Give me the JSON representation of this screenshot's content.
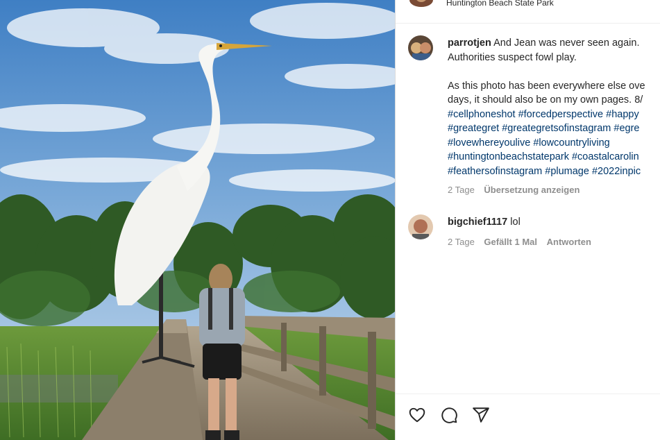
{
  "post": {
    "location": "Huntington Beach State Park"
  },
  "caption": {
    "username": "parrotjen",
    "first_line": "And Jean was never seen again.",
    "lines": [
      "Authorities suspect fowl play.",
      "",
      "As this photo has been everywhere else ove",
      "days, it should also be on my own pages. 8/"
    ],
    "hashtags": [
      [
        "#cellphoneshot",
        "#forcedperspective",
        "#happy"
      ],
      [
        "#greategret",
        "#greategretsofinstagram",
        "#egre"
      ],
      [
        "#lovewhereyoulive",
        "#lowcountryliving"
      ],
      [
        "#huntingtonbeachstatepark",
        "#coastalcarolin"
      ],
      [
        "#feathersofinstagram",
        "#plumage",
        "#2022inpic"
      ]
    ],
    "time": "2 Tage",
    "translate": "Übersetzung anzeigen"
  },
  "reply": {
    "username": "bigchief1117",
    "text": "lol",
    "time": "2 Tage",
    "likes": "Gefällt 1 Mal",
    "reply_label": "Antworten"
  },
  "actions": [
    {
      "name": "heart-icon"
    },
    {
      "name": "comment-icon"
    },
    {
      "name": "share-icon"
    }
  ],
  "colors": {
    "hashtag": "#00376b",
    "muted": "#8e8e8e",
    "text": "#262626"
  }
}
